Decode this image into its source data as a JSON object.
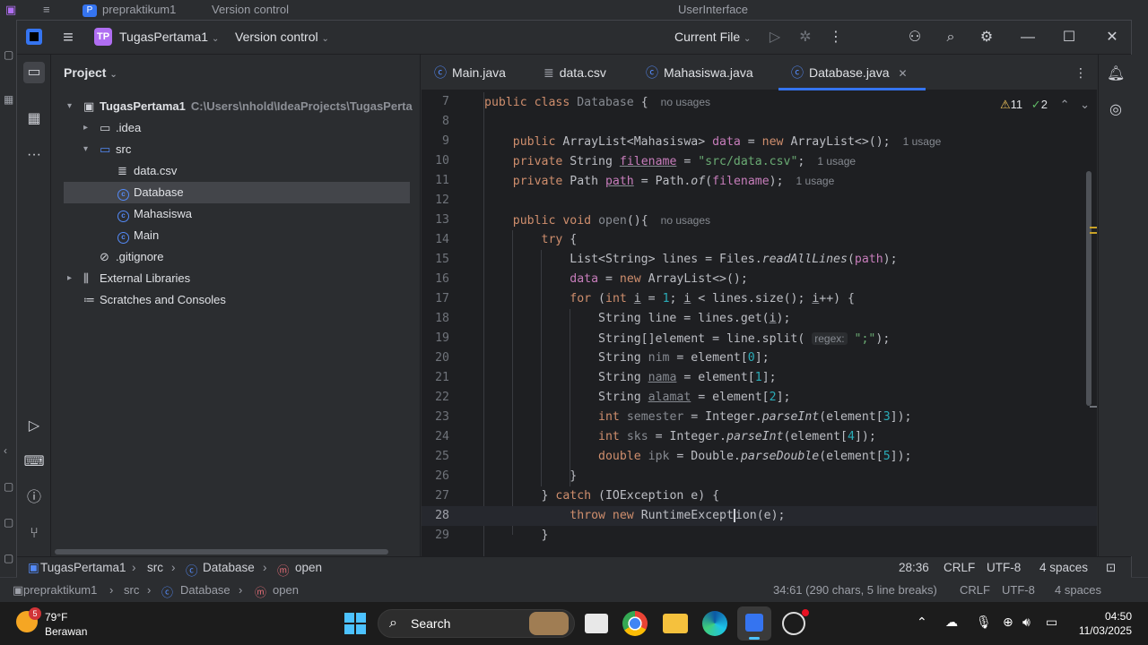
{
  "background_window": {
    "title_items": [
      "P",
      "prepraktikum1",
      "Version control",
      "UserInterface"
    ],
    "status_path": [
      "prepraktikum1",
      "src",
      "Database",
      "open"
    ],
    "status_right": [
      "34:61 (290 chars, 5 line breaks)",
      "CRLF",
      "UTF-8",
      "4 spaces"
    ]
  },
  "titlebar": {
    "project_badge": "TP",
    "project_name": "TugasPertama1",
    "vcs": "Version control",
    "run_config": "Current File"
  },
  "project_panel": {
    "title": "Project",
    "tree": [
      {
        "label": "TugasPertama1",
        "path": "C:\\Users\\nhold\\IdeaProjects\\TugasPerta",
        "arrow": "▾",
        "icon": "folder",
        "level": 0
      },
      {
        "label": ".idea",
        "arrow": "▸",
        "icon": "folder",
        "level": 1
      },
      {
        "label": "src",
        "arrow": "▾",
        "icon": "folder",
        "level": 1
      },
      {
        "label": "data.csv",
        "arrow": "",
        "icon": "file",
        "level": 2
      },
      {
        "label": "Database",
        "arrow": "",
        "icon": "class",
        "level": 2
      },
      {
        "label": "Mahasiswa",
        "arrow": "",
        "icon": "class",
        "level": 2
      },
      {
        "label": "Main",
        "arrow": "",
        "icon": "class",
        "level": 2
      },
      {
        "label": ".gitignore",
        "arrow": "",
        "icon": "ignore",
        "level": 1
      },
      {
        "label": "External Libraries",
        "arrow": "▸",
        "icon": "lib",
        "level": 0
      },
      {
        "label": "Scratches and Consoles",
        "arrow": "",
        "icon": "scratch",
        "level": 0
      }
    ]
  },
  "tabs": [
    {
      "label": "Main.java",
      "icon": "class"
    },
    {
      "label": "data.csv",
      "icon": "file"
    },
    {
      "label": "Mahasiswa.java",
      "icon": "class"
    },
    {
      "label": "Database.java",
      "icon": "class",
      "active": true
    }
  ],
  "inspections": {
    "warnings": "11",
    "ok": "2"
  },
  "code_lines": [
    {
      "n": "7"
    },
    {
      "n": "8"
    },
    {
      "n": "9"
    },
    {
      "n": "10"
    },
    {
      "n": "11"
    },
    {
      "n": "12"
    },
    {
      "n": "13"
    },
    {
      "n": "14"
    },
    {
      "n": "15"
    },
    {
      "n": "16"
    },
    {
      "n": "17"
    },
    {
      "n": "18"
    },
    {
      "n": "19"
    },
    {
      "n": "20"
    },
    {
      "n": "21"
    },
    {
      "n": "22"
    },
    {
      "n": "23"
    },
    {
      "n": "24"
    },
    {
      "n": "25"
    },
    {
      "n": "26"
    },
    {
      "n": "27"
    },
    {
      "n": "28"
    },
    {
      "n": "29"
    }
  ],
  "hints": {
    "no_usages": "no usages",
    "one_usage": "1 usage",
    "regex": "regex:"
  },
  "statusbar": {
    "breadcrumb": [
      "TugasPertama1",
      "src",
      "Database",
      "open"
    ],
    "position": "28:36",
    "line_sep": "CRLF",
    "encoding": "UTF-8",
    "indent": "4 spaces"
  },
  "taskbar": {
    "weather_badge": "5",
    "temperature": "79°F",
    "condition": "Berawan",
    "search": "Search",
    "time": "04:50",
    "date": "11/03/2025"
  },
  "colors": {
    "accent": "#3574f0",
    "keyword": "#cf8e6d",
    "string": "#6aab73",
    "field": "#c77dbb",
    "warning": "#f2c55c",
    "ok": "#5fb865"
  }
}
